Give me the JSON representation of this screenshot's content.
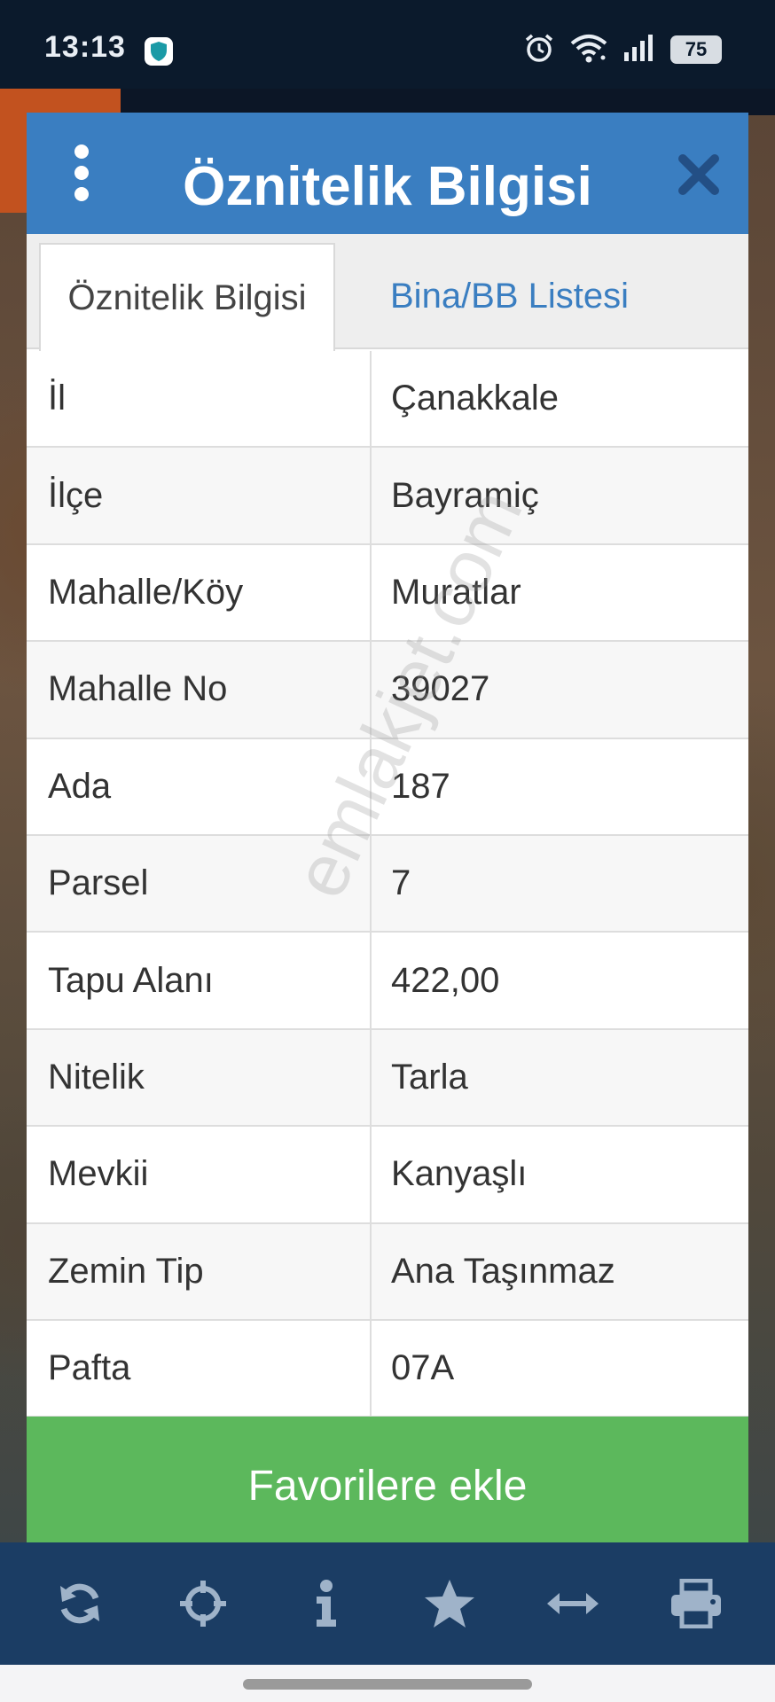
{
  "status_bar": {
    "time": "13:13",
    "battery": "75",
    "icons": [
      "shield-icon",
      "alarm-icon",
      "wifi-icon",
      "signal-icon",
      "battery-icon"
    ]
  },
  "dialog": {
    "title": "Öznitelik Bilgisi",
    "tabs": [
      {
        "label": "Öznitelik Bilgisi",
        "active": true
      },
      {
        "label": "Bina/BB Listesi",
        "active": false
      }
    ],
    "rows": [
      {
        "label": "İl",
        "value": "Çanakkale"
      },
      {
        "label": "İlçe",
        "value": "Bayramiç"
      },
      {
        "label": "Mahalle/Köy",
        "value": "Muratlar"
      },
      {
        "label": "Mahalle No",
        "value": "39027"
      },
      {
        "label": "Ada",
        "value": "187"
      },
      {
        "label": "Parsel",
        "value": "7"
      },
      {
        "label": "Tapu Alanı",
        "value": "422,00"
      },
      {
        "label": "Nitelik",
        "value": "Tarla"
      },
      {
        "label": "Mevkii",
        "value": "Kanyaşlı"
      },
      {
        "label": "Zemin Tip",
        "value": "Ana Taşınmaz"
      },
      {
        "label": "Pafta",
        "value": "07A"
      }
    ],
    "favorite_button": "Favorilere ekle",
    "watermark": "emlakjet.com"
  },
  "toolbar": {
    "icons": [
      "refresh-icon",
      "crosshair-icon",
      "info-icon",
      "star-icon",
      "measure-icon",
      "print-icon"
    ]
  },
  "colors": {
    "header": "#3a7ec1",
    "favorite": "#5cb85c",
    "toolbar": "#1b3d64",
    "toolbar_icon": "#9fb3c9"
  }
}
